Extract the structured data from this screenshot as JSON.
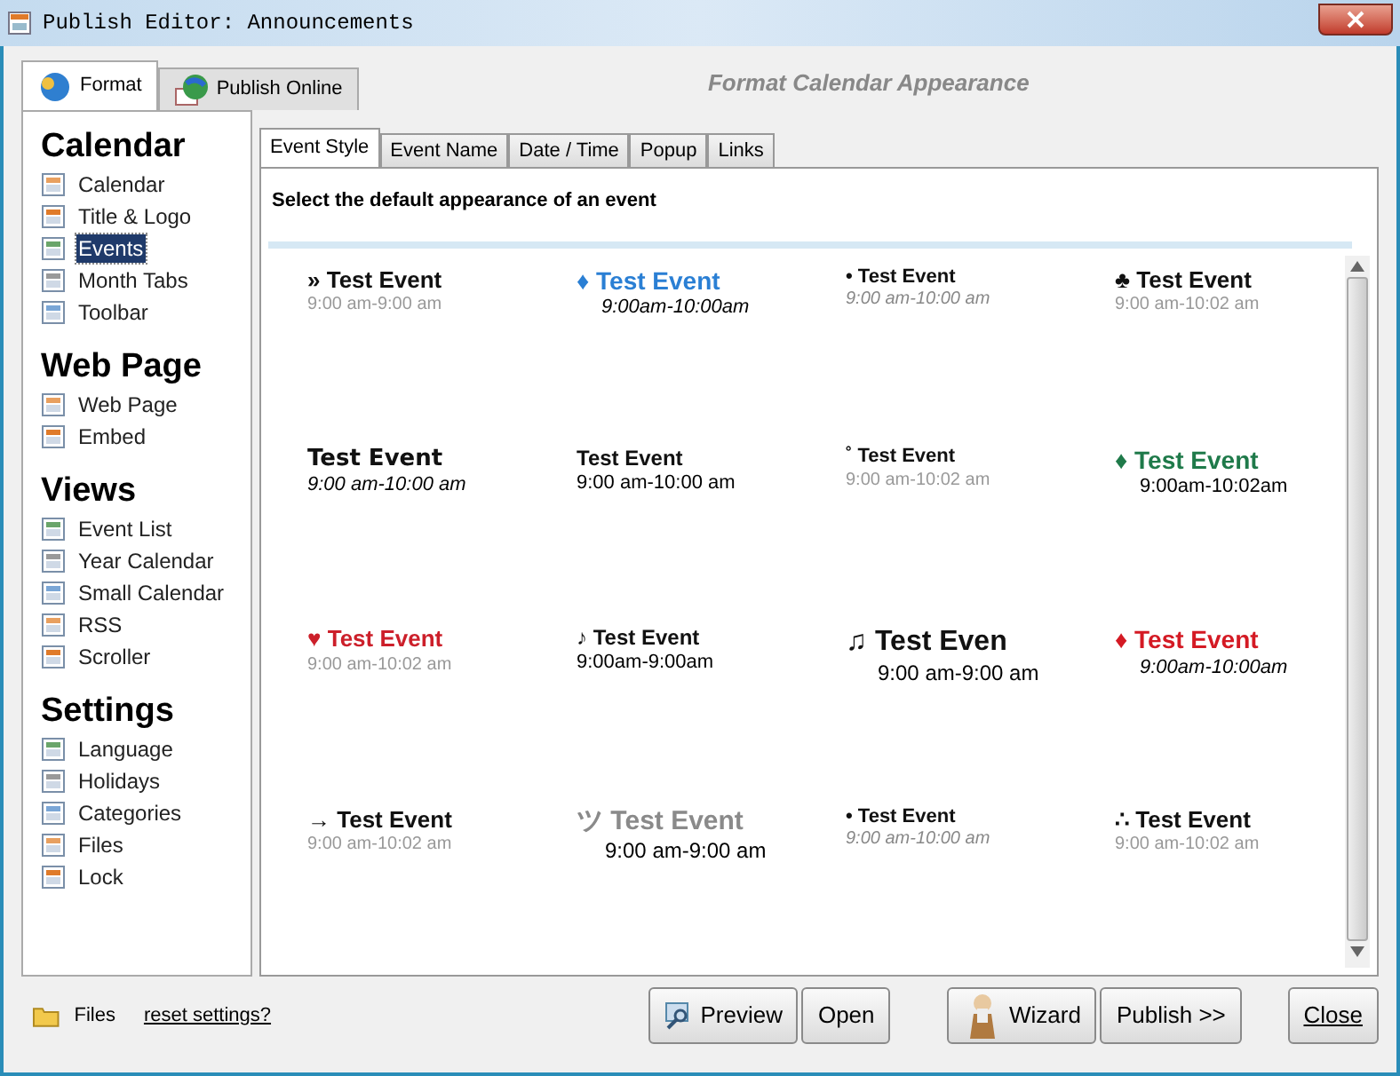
{
  "window": {
    "title": "Publish Editor: Announcements"
  },
  "main_tabs": [
    {
      "label": "Format",
      "selected": true
    },
    {
      "label": "Publish Online",
      "selected": false
    }
  ],
  "heading": "Format Calendar Appearance",
  "sidebar": [
    {
      "title": "Calendar",
      "items": [
        {
          "label": "Calendar",
          "selected": false
        },
        {
          "label": "Title & Logo",
          "selected": false
        },
        {
          "label": "Events",
          "selected": true
        },
        {
          "label": "Month Tabs",
          "selected": false
        },
        {
          "label": "Toolbar",
          "selected": false
        }
      ]
    },
    {
      "title": "Web Page",
      "items": [
        {
          "label": "Web Page",
          "selected": false
        },
        {
          "label": "Embed",
          "selected": false
        }
      ]
    },
    {
      "title": "Views",
      "items": [
        {
          "label": "Event List",
          "selected": false
        },
        {
          "label": "Year Calendar",
          "selected": false
        },
        {
          "label": "Small Calendar",
          "selected": false
        },
        {
          "label": "RSS",
          "selected": false
        },
        {
          "label": "Scroller",
          "selected": false
        }
      ]
    },
    {
      "title": "Settings",
      "items": [
        {
          "label": "Language",
          "selected": false
        },
        {
          "label": "Holidays",
          "selected": false
        },
        {
          "label": "Categories",
          "selected": false
        },
        {
          "label": "Files",
          "selected": false
        },
        {
          "label": "Lock",
          "selected": false
        }
      ]
    }
  ],
  "sub_tabs": [
    {
      "label": "Event Style",
      "selected": true
    },
    {
      "label": "Event Name",
      "selected": false
    },
    {
      "label": "Date / Time",
      "selected": false
    },
    {
      "label": "Popup",
      "selected": false
    },
    {
      "label": "Links",
      "selected": false
    }
  ],
  "instruction": "Select the default appearance of an event",
  "event_styles": [
    {
      "kind": "classic",
      "marker": "»",
      "title": "Test Event",
      "time": "9:00 am-9:00 am",
      "color": "#111111"
    },
    {
      "kind": "accent",
      "marker": "♦",
      "title": "Test Event",
      "time": "9:00am-10:00am",
      "color": "#2a7fd4"
    },
    {
      "kind": "small",
      "marker": "•",
      "title": "Test Event",
      "time": "9:00 am-10:00 am",
      "color": "#111111"
    },
    {
      "kind": "classic",
      "marker": "♣",
      "title": "Test Event",
      "time": "9:00 am-10:02 am",
      "color": "#111111"
    },
    {
      "kind": "bolditalic",
      "title": "Test Event",
      "time": "9:00 am-10:00 am",
      "color": "#111111"
    },
    {
      "kind": "plain",
      "title": "Test Event",
      "time": "9:00 am-10:00 am",
      "color": "#111111"
    },
    {
      "kind": "smallgray",
      "marker": "˚",
      "title": "Test Event",
      "time": "9:00 am-10:02 am",
      "color": "#111111"
    },
    {
      "kind": "accentupright",
      "marker": "♦",
      "title": "Test Event",
      "time": "9:00am-10:02am",
      "color": "#1f7a4a"
    },
    {
      "kind": "classic",
      "marker": "♥",
      "title": "Test Event",
      "time": "9:00 am-10:02 am",
      "color": "#cc1f2a"
    },
    {
      "kind": "plain",
      "marker": "♪",
      "title": "Test Event",
      "time": "9:00am-9:00am",
      "color": "#111111"
    },
    {
      "kind": "large",
      "marker": "♫",
      "title": "Test Even",
      "time": "9:00 am-9:00 am",
      "color": "#111111"
    },
    {
      "kind": "accent",
      "marker": "♦",
      "title": "Test Event",
      "time": "9:00am-10:00am",
      "color": "#d41a24"
    },
    {
      "kind": "classic",
      "marker": "→",
      "title": "Test Event",
      "time": "9:00 am-10:02 am",
      "color": "#111111"
    },
    {
      "kind": "faded",
      "marker": "ツ",
      "title": "Test Event",
      "time": "9:00 am-9:00 am",
      "color": "#8a8a8a"
    },
    {
      "kind": "small",
      "marker": "•",
      "title": "Test Event",
      "time": "9:00 am-10:00 am",
      "color": "#111111"
    },
    {
      "kind": "classic",
      "marker": "∴",
      "title": "Test Event",
      "time": "9:00 am-10:02 am",
      "color": "#111111"
    }
  ],
  "footer": {
    "files": "Files",
    "reset": "reset settings?",
    "buttons": [
      {
        "kind": "preview",
        "label": "Preview"
      },
      {
        "kind": "plain",
        "label": "Open"
      },
      {
        "kind": "wizard",
        "label": "Wizard"
      },
      {
        "kind": "plain",
        "label": "Publish >>"
      },
      {
        "kind": "close",
        "label": "Close"
      }
    ]
  }
}
